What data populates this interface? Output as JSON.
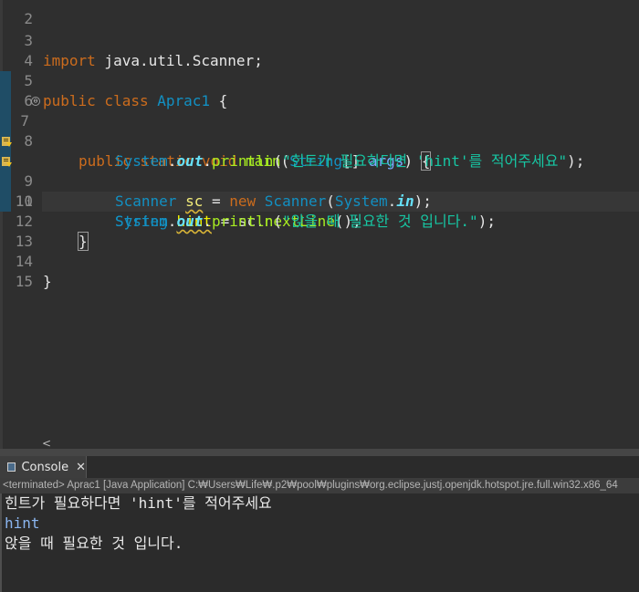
{
  "editor": {
    "lines": [
      {
        "n": "2"
      },
      {
        "n": "3",
        "text": "import java.util.Scanner;"
      },
      {
        "n": "4"
      },
      {
        "n": "5",
        "kw": "public class ",
        "cls": "Aprac1",
        "rest": " {"
      },
      {
        "n": "6"
      },
      {
        "n": "7",
        "fold": "⊖"
      },
      {
        "n": "8"
      },
      {
        "n": "9"
      },
      {
        "n": "10"
      },
      {
        "n": "11"
      },
      {
        "n": "12"
      },
      {
        "n": "13"
      },
      {
        "n": "14",
        "text": "}"
      },
      {
        "n": "15"
      }
    ],
    "l7": {
      "kw": "public static void ",
      "method": "main",
      "p1": "(",
      "cls": "String",
      "p2": "[] ",
      "param": "args",
      "p3": ") ",
      "brace": "{"
    },
    "l8": {
      "cls": "System",
      "dot1": ".",
      "field": "out",
      "dot2": ".",
      "method": "println",
      "p1": "(",
      "str": "\"힌트가 필요하다면 'hint'를 적어주세요\"",
      "p2": ");"
    },
    "l9": {
      "cls1": "Scanner",
      "sp": " ",
      "var": "sc",
      "eq": " = ",
      "kw": "new",
      "sp2": " ",
      "cls2": "Scanner",
      "p1": "(",
      "cls3": "System",
      "dot": ".",
      "field": "in",
      "p2": ");"
    },
    "l10": {
      "cls": "String",
      "sp": " ",
      "var": "hint",
      "eq": " = sc.",
      "method": "nextLine",
      "p": "();"
    },
    "l11": {
      "cls": "System",
      "dot1": ".",
      "field": "out",
      "dot2": ".",
      "method": "println",
      "p1": "(",
      "str": "\"앉을 때 필요한 것 입니다.\"",
      "p2": ");"
    },
    "l12": {
      "brace": "}"
    },
    "hscroll_left": "<"
  },
  "console": {
    "tab_label": "Console",
    "close": "✕",
    "status": "<terminated> Aprac1 [Java Application] C:₩Users₩Life₩.p2₩pool₩plugins₩org.eclipse.justj.openjdk.hotspot.jre.full.win32.x86_64",
    "output": [
      {
        "text": "힌트가 필요하다면 'hint'를 적어주세요",
        "input": false
      },
      {
        "text": "hint",
        "input": true
      },
      {
        "text": "앉을 때 필요한 것 입니다.",
        "input": false
      }
    ]
  },
  "colors": {
    "keyword": "#cc6c1d",
    "class": "#1290c3",
    "method": "#a7ec21",
    "string": "#17c6a3",
    "field": "#66e1f8",
    "variable": "#f3ec79",
    "console_input": "#8bb6f0"
  }
}
